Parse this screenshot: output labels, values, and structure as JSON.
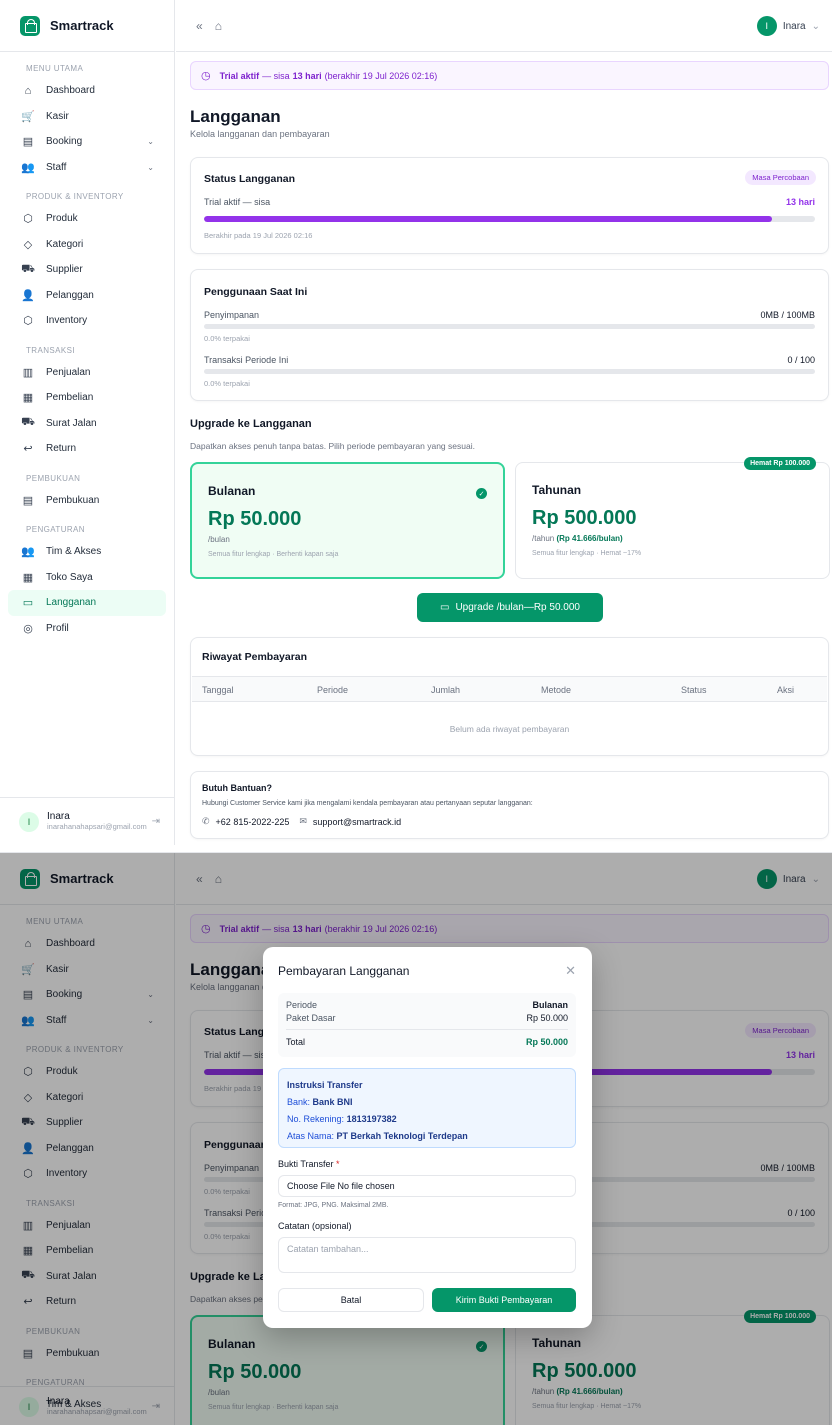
{
  "app": {
    "name": "Smartrack"
  },
  "user": {
    "name": "Inara",
    "initial": "I",
    "email": "inarahanahapsari@gmail.com"
  },
  "sidebar": {
    "sections": [
      {
        "title": "MENU UTAMA",
        "items": [
          {
            "label": "Dashboard",
            "icon": "home-icon",
            "glyph": "⌂"
          },
          {
            "label": "Kasir",
            "icon": "cart-icon",
            "glyph": "🛒"
          },
          {
            "label": "Booking",
            "icon": "calendar-icon",
            "glyph": "▤",
            "chevron": true
          },
          {
            "label": "Staff",
            "icon": "staff-icon",
            "glyph": "👥",
            "chevron": true
          }
        ]
      },
      {
        "title": "PRODUK & INVENTORY",
        "items": [
          {
            "label": "Produk",
            "icon": "box-icon",
            "glyph": "⬡"
          },
          {
            "label": "Kategori",
            "icon": "tag-icon",
            "glyph": "◇"
          },
          {
            "label": "Supplier",
            "icon": "truck-icon",
            "glyph": "⛟"
          },
          {
            "label": "Pelanggan",
            "icon": "users-icon",
            "glyph": "👤"
          },
          {
            "label": "Inventory",
            "icon": "package-icon",
            "glyph": "⬡"
          }
        ]
      },
      {
        "title": "TRANSAKSI",
        "items": [
          {
            "label": "Penjualan",
            "icon": "chart-icon",
            "glyph": "▥"
          },
          {
            "label": "Pembelian",
            "icon": "clipboard-icon",
            "glyph": "▦"
          },
          {
            "label": "Surat Jalan",
            "icon": "delivery-icon",
            "glyph": "⛟"
          },
          {
            "label": "Return",
            "icon": "return-icon",
            "glyph": "↩"
          }
        ]
      },
      {
        "title": "PEMBUKUAN",
        "items": [
          {
            "label": "Pembukuan",
            "icon": "ledger-icon",
            "glyph": "▤"
          }
        ]
      },
      {
        "title": "PENGATURAN",
        "items": [
          {
            "label": "Tim & Akses",
            "icon": "team-icon",
            "glyph": "👥"
          },
          {
            "label": "Toko Saya",
            "icon": "store-icon",
            "glyph": "▦"
          },
          {
            "label": "Langganan",
            "icon": "credit-card-icon",
            "glyph": "▭",
            "active": true
          },
          {
            "label": "Profil",
            "icon": "profile-icon",
            "glyph": "◎"
          }
        ]
      }
    ]
  },
  "topbar": {
    "collapse_glyph": "«",
    "home_glyph": "⌂",
    "user_chevron": "⌄"
  },
  "trial_banner": {
    "icon": "clock-icon",
    "glyph": "◷",
    "bold": "Trial aktif",
    "text1": "— sisa",
    "days": "13 hari",
    "text2": "(berakhir 19 Jul 2026 02:16)"
  },
  "page": {
    "title": "Langganan",
    "subtitle": "Kelola langganan dan pembayaran"
  },
  "status_card": {
    "title": "Status Langganan",
    "badge": "Masa Percobaan",
    "label": "Trial aktif — sisa",
    "value": "13 hari",
    "progress": 0.93,
    "expiry": "Berakhir pada 19 Jul 2026 02:16"
  },
  "usage_card": {
    "title": "Penggunaan Saat Ini",
    "rows": [
      {
        "label": "Penyimpanan",
        "value": "0MB / 100MB",
        "note": "0.0% terpakai",
        "progress": 0
      },
      {
        "label": "Transaksi Periode Ini",
        "value": "0 / 100",
        "note": "0.0% terpakai",
        "progress": 0
      }
    ]
  },
  "upgrade": {
    "title": "Upgrade ke Langganan",
    "subtitle": "Dapatkan akses penuh tanpa batas. Pilih periode pembayaran yang sesuai.",
    "monthly": {
      "name": "Bulanan",
      "price": "Rp 50.000",
      "unit": "/bulan",
      "features": "Semua fitur lengkap · Berhenti kapan saja",
      "selected": true
    },
    "yearly": {
      "name": "Tahunan",
      "price": "Rp 500.000",
      "unit": "/tahun",
      "unit_highlight": "(Rp 41.666/bulan)",
      "features": "Semua fitur lengkap · Hemat ~17%",
      "badge": "Hemat Rp 100.000"
    },
    "cta": "Upgrade /bulan—Rp 50.000"
  },
  "history": {
    "title": "Riwayat Pembayaran",
    "columns": [
      "Tanggal",
      "Periode",
      "Jumlah",
      "Metode",
      "Status",
      "Aksi"
    ],
    "empty": "Belum ada riwayat pembayaran"
  },
  "help": {
    "title": "Butuh Bantuan?",
    "text": "Hubungi Customer Service kami jika mengalami kendala pembayaran atau pertanyaan seputar langganan:",
    "phone": "+62 815-2022-225",
    "email": "support@smartrack.id"
  },
  "modal": {
    "title": "Pembayaran Langganan",
    "close": "✕",
    "summary": {
      "periode_label": "Periode",
      "periode_value": "Bulanan",
      "paket_label": "Paket Dasar",
      "paket_value": "Rp 50.000",
      "total_label": "Total",
      "total_value": "Rp 50.000"
    },
    "bank": {
      "title": "Instruksi Transfer",
      "bank_label": "Bank:",
      "bank_value": "Bank BNI",
      "acct_label": "No. Rekening:",
      "acct_value": "1813197382",
      "name_label": "Atas Nama:",
      "name_value": "PT Berkah Teknologi Terdepan"
    },
    "proof_label": "Bukti Transfer",
    "required_mark": "*",
    "file_button": "Choose File",
    "file_status": "No file chosen",
    "file_hint": "Format: JPG, PNG. Maksimal 2MB.",
    "note_label": "Catatan (opsional)",
    "note_placeholder": "Catatan tambahan...",
    "cancel": "Batal",
    "submit": "Kirim Bukti Pembayaran"
  },
  "colors": {
    "accent": "#059669",
    "purple": "#9333ea"
  }
}
